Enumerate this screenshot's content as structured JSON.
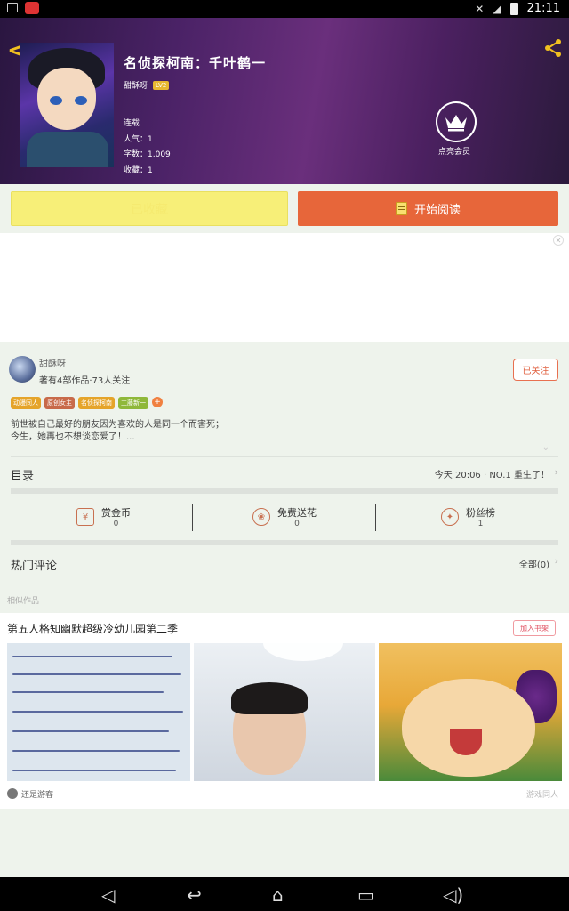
{
  "status_bar": {
    "time": "21:11"
  },
  "book": {
    "title": "名侦探柯南：千叶鹤一",
    "author": "甜酥呀",
    "level": "LV2",
    "status": "连载",
    "popularity": "人气：1",
    "word_count": "字数：1,009",
    "favorites": "收藏：1",
    "vip_label": "点亮会员"
  },
  "actions": {
    "follow_label": "已收藏",
    "read_label": "开始阅读"
  },
  "author_card": {
    "name": "甜酥呀",
    "stats": "著有4部作品·73人关注",
    "follow_button": "已关注",
    "tags": [
      {
        "label": "动漫同人",
        "color": "#e5a42a"
      },
      {
        "label": "原创女主",
        "color": "#c86a4a"
      },
      {
        "label": "名侦探柯南",
        "color": "#e5a42a"
      },
      {
        "label": "工藤新一",
        "color": "#8fb83a"
      }
    ],
    "tag_add": "+",
    "description_lines": [
      "前世被自己最好的朋友因为喜欢的人是同一个而害死；",
      "今生，她再也不想谈恋爱了！..."
    ]
  },
  "catalog": {
    "title": "目录",
    "latest": "今天 20:06 · NO.1 重生了！"
  },
  "stats": [
    {
      "label": "赏金币",
      "value": "0"
    },
    {
      "label": "免费送花",
      "value": "0"
    },
    {
      "label": "粉丝榜",
      "value": "1"
    }
  ],
  "comments": {
    "title": "热门评论",
    "count": "全部(0)"
  },
  "similar": {
    "section_label": "相似作品",
    "title": "第五人格知幽默超级冷幼儿园第二季",
    "add_button": "加入书架",
    "user": "还是游客",
    "category": "游戏同人"
  },
  "icons": {
    "back": "chevron-left-icon",
    "share": "share-icon",
    "vip": "crown-icon"
  },
  "colors": {
    "accent_orange": "#e7663a",
    "accent_yellow": "#f7ef78",
    "hero_purple": "#4a2266"
  }
}
